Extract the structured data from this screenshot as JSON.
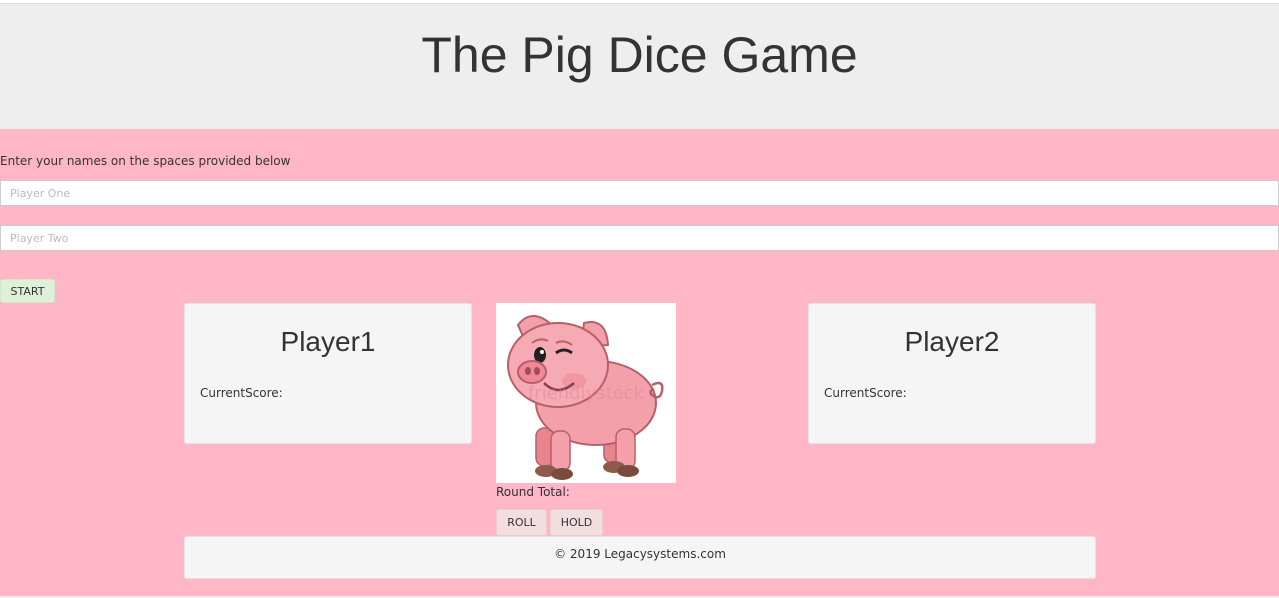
{
  "header": {
    "title": "The Pig Dice Game"
  },
  "form": {
    "instructions": "Enter your names on the spaces provided below",
    "player_one_placeholder": "Player One",
    "player_two_placeholder": "Player Two",
    "start_label": "START"
  },
  "players": [
    {
      "name": "Player1",
      "score_label": "CurrentScore:"
    },
    {
      "name": "Player2",
      "score_label": "CurrentScore:"
    }
  ],
  "center": {
    "image_icon": "pig-icon",
    "watermark": "friendlystock",
    "round_total_label": "Round Total:",
    "roll_label": "ROLL",
    "hold_label": "HOLD"
  },
  "footer": {
    "text": "© 2019 Legacysystems.com"
  },
  "colors": {
    "page_background": "#ffb6c6",
    "header_background": "#eeeeee",
    "start_button": "#dff0d8",
    "action_button": "#f2dede"
  }
}
